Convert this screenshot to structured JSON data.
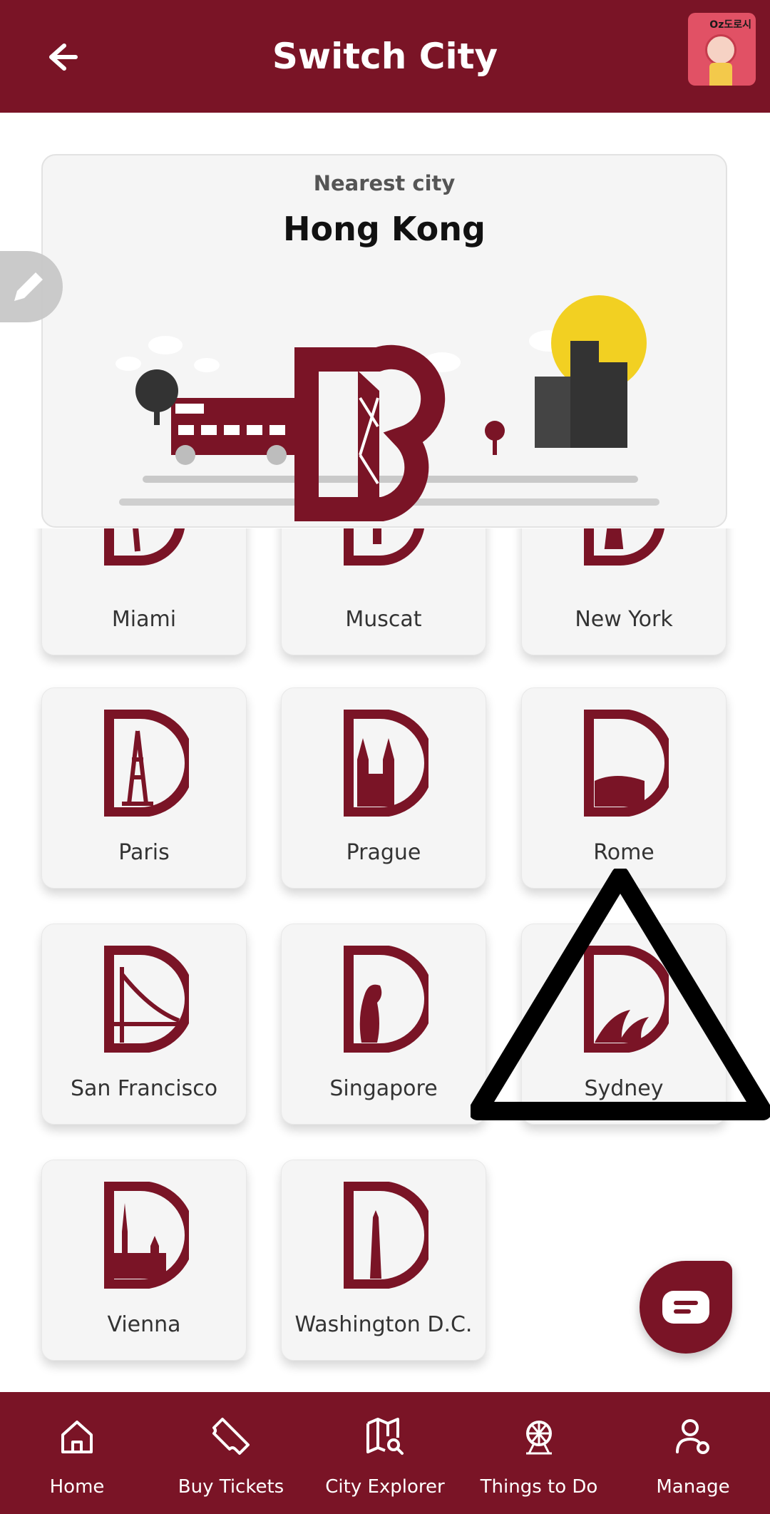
{
  "header": {
    "title": "Switch City",
    "badge_text": "Oz도로시"
  },
  "nearest": {
    "label": "Nearest city",
    "city": "Hong Kong"
  },
  "cities": [
    {
      "name": "Miami",
      "icon": "palm-tree-icon"
    },
    {
      "name": "Muscat",
      "icon": "incense-burner-icon"
    },
    {
      "name": "New York",
      "icon": "statue-of-liberty-icon"
    },
    {
      "name": "Paris",
      "icon": "eiffel-tower-icon"
    },
    {
      "name": "Prague",
      "icon": "prague-church-icon"
    },
    {
      "name": "Rome",
      "icon": "colosseum-icon"
    },
    {
      "name": "San Francisco",
      "icon": "golden-gate-bridge-icon"
    },
    {
      "name": "Singapore",
      "icon": "merlion-icon"
    },
    {
      "name": "Sydney",
      "icon": "opera-house-icon"
    },
    {
      "name": "Vienna",
      "icon": "vienna-cathedral-icon"
    },
    {
      "name": "Washington D.C.",
      "icon": "washington-monument-icon"
    }
  ],
  "bottom_nav": [
    {
      "label": "Home",
      "icon": "home-icon"
    },
    {
      "label": "Buy Tickets",
      "icon": "ticket-icon"
    },
    {
      "label": "City Explorer",
      "icon": "map-search-icon"
    },
    {
      "label": "Things to Do",
      "icon": "ferris-wheel-icon"
    },
    {
      "label": "Manage",
      "icon": "user-settings-icon"
    }
  ],
  "colors": {
    "brand": "#7a1426",
    "tile": "#f5f5f5"
  }
}
